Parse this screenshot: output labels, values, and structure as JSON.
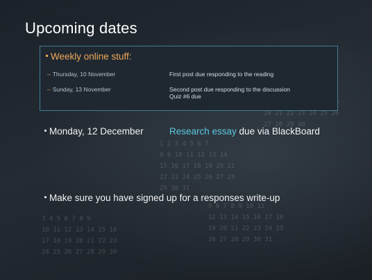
{
  "slide": {
    "title": "Upcoming dates",
    "weekly": {
      "heading": "Weekly online stuff:",
      "rows": [
        {
          "date": "Thursday, 10 November",
          "desc": [
            "First post due responding to the reading"
          ]
        },
        {
          "date": "Sunday, 13 November",
          "desc": [
            "Second post due responding to the discussion",
            "Quiz #6 due"
          ]
        }
      ]
    },
    "essay": {
      "date": "Monday, 12 December",
      "highlight": "Research essay",
      "rest": " due via BlackBoard"
    },
    "reminder": "Make sure you have signed up for a responses write-up"
  },
  "colors": {
    "accent_orange": "#f0a858",
    "accent_cyan": "#5cc8e0",
    "box_border": "#3f7f96"
  }
}
